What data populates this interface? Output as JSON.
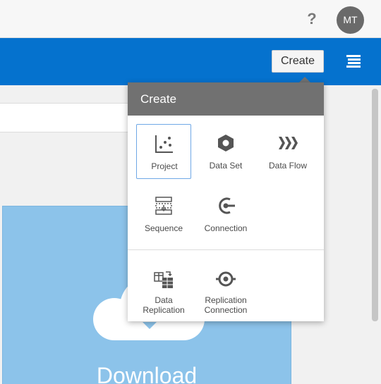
{
  "header": {
    "help_label": "?",
    "avatar_initials": "MT"
  },
  "toolbar": {
    "create_label": "Create",
    "menu_icon": "hamburger-menu-icon"
  },
  "card": {
    "title": "Download"
  },
  "create_menu": {
    "title": "Create",
    "items": [
      {
        "label": "Project",
        "icon": "project-scatter-icon"
      },
      {
        "label": "Data Set",
        "icon": "hexagon-icon"
      },
      {
        "label": "Data Flow",
        "icon": "chevrons-right-icon"
      },
      {
        "label": "Sequence",
        "icon": "sequence-icon"
      },
      {
        "label": "Connection",
        "icon": "connection-icon"
      }
    ],
    "replication_items": [
      {
        "label_line1": "Data",
        "label_line2": "Replication",
        "icon": "data-replication-icon"
      },
      {
        "label_line1": "Replication",
        "label_line2": "Connection",
        "icon": "replication-connection-icon"
      }
    ]
  },
  "colors": {
    "brand_blue": "#0572ce",
    "menu_header": "#717171",
    "card_blue": "#8cc3ea",
    "selected_border": "#6fa8e6"
  }
}
